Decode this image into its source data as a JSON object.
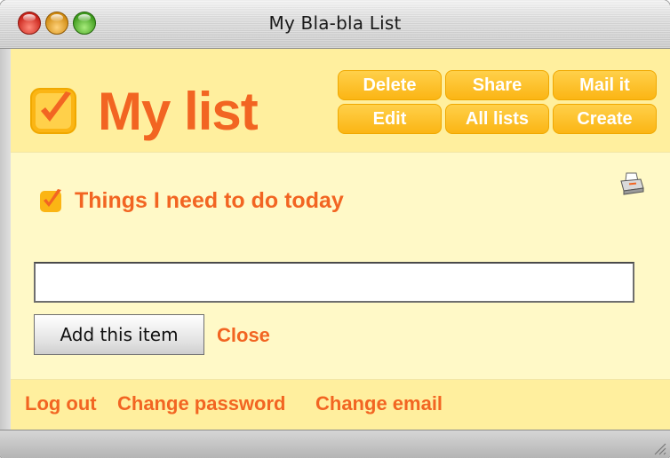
{
  "window": {
    "title": "My Bla-bla List"
  },
  "header": {
    "logo_text": "My list",
    "buttons": [
      {
        "label": "Delete"
      },
      {
        "label": "Share"
      },
      {
        "label": "Mail it"
      },
      {
        "label": "Edit"
      },
      {
        "label": "All lists"
      },
      {
        "label": "Create"
      }
    ]
  },
  "list": {
    "title": "Things I need to do today",
    "new_item_value": "",
    "add_button_label": "Add this item",
    "close_label": "Close",
    "print_icon": "printer-icon"
  },
  "footer": {
    "links": [
      {
        "label": "Log out"
      },
      {
        "label": "Change password"
      },
      {
        "label": "Change email"
      }
    ]
  },
  "colors": {
    "accent": "#f26522",
    "button": "#fbb514",
    "header_bg": "#ffef9e",
    "content_bg": "#fff9c7"
  }
}
